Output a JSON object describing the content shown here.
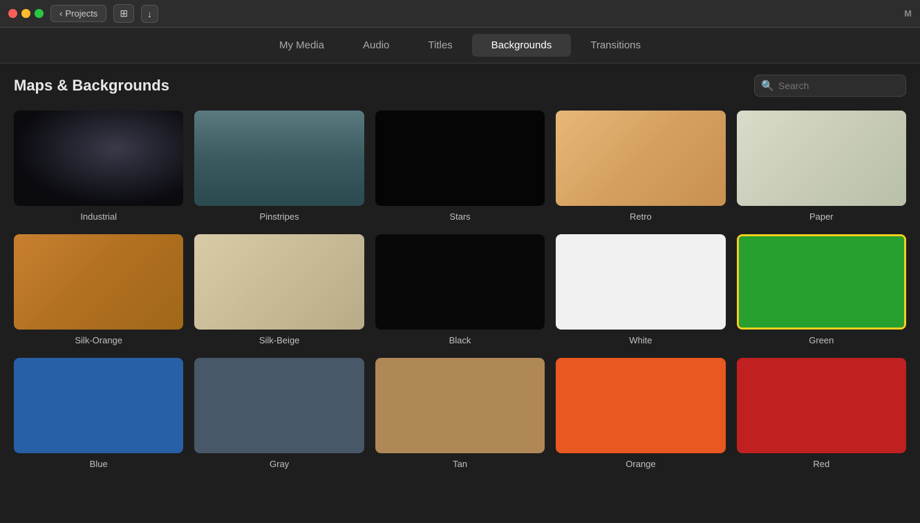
{
  "titlebar": {
    "projects_label": "Projects",
    "window_label": "M"
  },
  "tabs": [
    {
      "id": "my-media",
      "label": "My Media",
      "active": false
    },
    {
      "id": "audio",
      "label": "Audio",
      "active": false
    },
    {
      "id": "titles",
      "label": "Titles",
      "active": false
    },
    {
      "id": "backgrounds",
      "label": "Backgrounds",
      "active": true
    },
    {
      "id": "transitions",
      "label": "Transitions",
      "active": false
    }
  ],
  "section": {
    "title": "Maps & Backgrounds",
    "search_placeholder": "Search"
  },
  "grid": [
    {
      "id": "industrial",
      "label": "Industrial",
      "bg_class": "bg-industrial",
      "selected": false
    },
    {
      "id": "pinstripes",
      "label": "Pinstripes",
      "bg_class": "bg-pinstripes",
      "selected": false
    },
    {
      "id": "stars",
      "label": "Stars",
      "bg_class": "bg-stars",
      "selected": false
    },
    {
      "id": "retro",
      "label": "Retro",
      "bg_class": "bg-retro",
      "selected": false
    },
    {
      "id": "paper",
      "label": "Paper",
      "bg_class": "bg-paper",
      "selected": false
    },
    {
      "id": "silk-orange",
      "label": "Silk-Orange",
      "bg_class": "bg-silk-orange",
      "selected": false
    },
    {
      "id": "silk-beige",
      "label": "Silk-Beige",
      "bg_class": "bg-silk-beige",
      "selected": false
    },
    {
      "id": "black",
      "label": "Black",
      "bg_class": "bg-black",
      "selected": false
    },
    {
      "id": "white",
      "label": "White",
      "bg_class": "bg-white",
      "selected": false
    },
    {
      "id": "green",
      "label": "Green",
      "bg_class": "bg-green",
      "selected": true
    },
    {
      "id": "blue",
      "label": "Blue",
      "bg_class": "bg-blue",
      "selected": false
    },
    {
      "id": "gray",
      "label": "Gray",
      "bg_class": "bg-gray",
      "selected": false
    },
    {
      "id": "tan",
      "label": "Tan",
      "bg_class": "bg-tan",
      "selected": false
    },
    {
      "id": "orange",
      "label": "Orange",
      "bg_class": "bg-orange",
      "selected": false
    },
    {
      "id": "red",
      "label": "Red",
      "bg_class": "bg-red",
      "selected": false
    }
  ]
}
